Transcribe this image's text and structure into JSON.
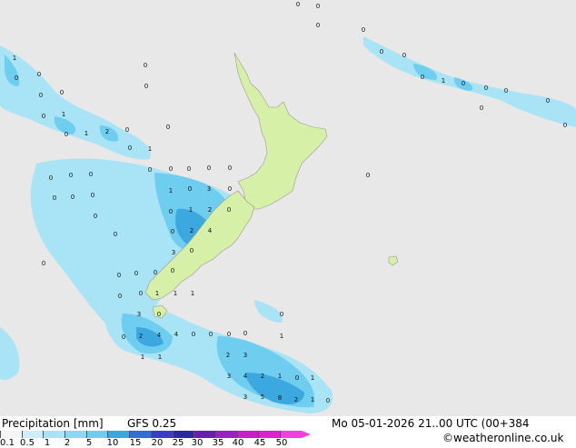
{
  "map": {
    "colors": {
      "sea": "#e8e8e8",
      "land": "#d6f0a8",
      "precip_light": "#a8e4f5",
      "precip_mid": "#6fcdef",
      "precip_strong": "#3ca8e0",
      "precip_heavy": "#2f6fd6"
    },
    "values": [
      "0",
      "0",
      "0",
      "0",
      "1",
      "0",
      "0",
      "0",
      "0",
      "0",
      "0",
      "1",
      "2",
      "0",
      "0",
      "0",
      "1",
      "0",
      "0",
      "0",
      "1",
      "0",
      "0",
      "0",
      "0",
      "0",
      "0",
      "1",
      "0",
      "0",
      "0",
      "0",
      "0",
      "0",
      "0",
      "0",
      "0",
      "0",
      "0",
      "0",
      "0",
      "0",
      "1",
      "0",
      "3",
      "0",
      "0",
      "1",
      "2",
      "0",
      "0",
      "2",
      "4",
      "0",
      "3",
      "0",
      "0",
      "0",
      "0",
      "0",
      "0",
      "0",
      "0",
      "1",
      "1",
      "1",
      "3",
      "0",
      "0",
      "2",
      "4",
      "4",
      "0",
      "0",
      "0",
      "0",
      "0",
      "0",
      "1",
      "1",
      "1",
      "2",
      "3",
      "3",
      "4",
      "2",
      "1",
      "0",
      "1",
      "3",
      "5",
      "8",
      "2",
      "1",
      "0"
    ]
  },
  "footer": {
    "title": "Precipitation [mm]",
    "model": "GFS 0.25",
    "datetime": "Mo 05-01-2026 21..00 UTC (00+384",
    "credit": "©weatheronline.co.uk"
  },
  "legend": {
    "ticks": [
      "0.1",
      "0.5",
      "1",
      "2",
      "5",
      "10",
      "15",
      "20",
      "25",
      "30",
      "35",
      "40",
      "45",
      "50"
    ],
    "colors": [
      "#f5f5f5",
      "#cdeefa",
      "#a8e4f5",
      "#8ad9f2",
      "#6fcdef",
      "#3ca8e0",
      "#2f6fd6",
      "#3a3ec4",
      "#2a2a9e",
      "#6a1fb0",
      "#9c1fc4",
      "#c81fc8",
      "#e020d0",
      "#f040e0"
    ]
  }
}
